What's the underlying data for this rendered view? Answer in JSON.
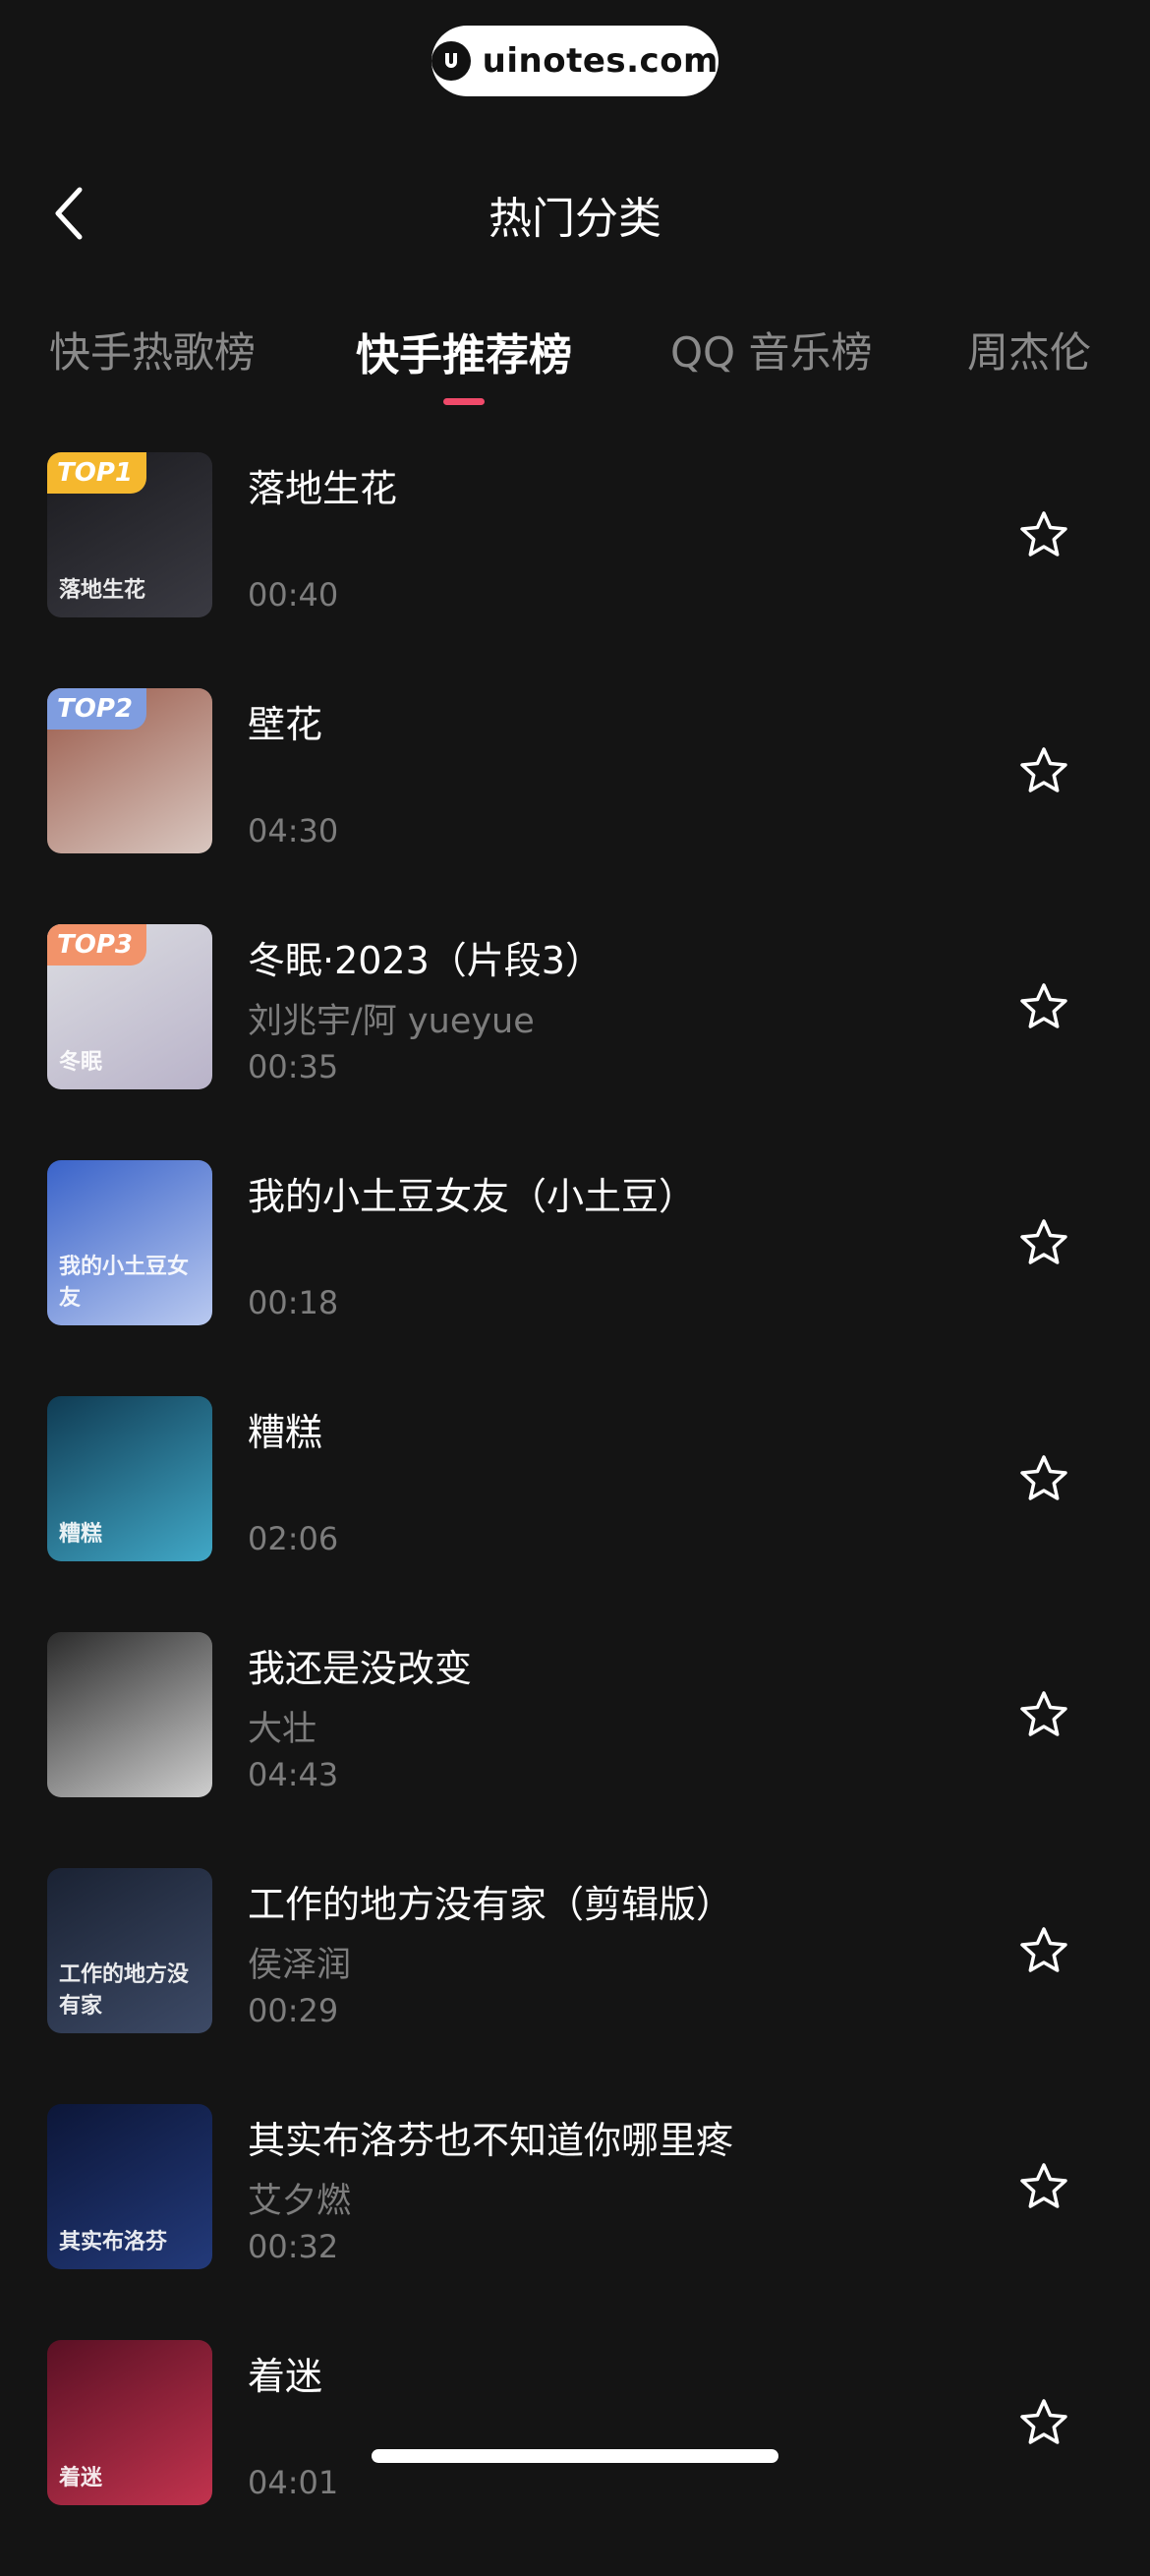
{
  "watermark": {
    "text": "uinotes.com"
  },
  "header": {
    "title": "热门分类"
  },
  "tabs": [
    {
      "label": "快手热歌榜",
      "active": false
    },
    {
      "label": "快手推荐榜",
      "active": true
    },
    {
      "label": "QQ 音乐榜",
      "active": false
    },
    {
      "label": "周杰伦",
      "active": false
    }
  ],
  "songs": [
    {
      "title": "落地生花",
      "artist": "",
      "duration": "00:40",
      "badge": "TOP1",
      "badge_color": "#f5b82e",
      "cover_text": "落地生花",
      "cover_colors": [
        "#1b1b1f",
        "#3a3a42"
      ]
    },
    {
      "title": "壁花",
      "artist": "",
      "duration": "04:30",
      "badge": "TOP2",
      "badge_color": "#7f9de0",
      "cover_text": "",
      "cover_colors": [
        "#9a5a4a",
        "#d9c7c0"
      ]
    },
    {
      "title": "冬眠·2023（片段3）",
      "artist": "刘兆宇/阿 yueyue",
      "duration": "00:35",
      "badge": "TOP3",
      "badge_color": "#f2936a",
      "cover_text": "冬眠",
      "cover_colors": [
        "#dcdde2",
        "#b9b3c9"
      ]
    },
    {
      "title": "我的小土豆女友（小土豆）",
      "artist": "",
      "duration": "00:18",
      "badge": "",
      "badge_color": "",
      "cover_text": "我的小土豆女友",
      "cover_colors": [
        "#3a63c9",
        "#b9c9f0"
      ]
    },
    {
      "title": "糟糕",
      "artist": "",
      "duration": "02:06",
      "badge": "",
      "badge_color": "",
      "cover_text": "糟糕",
      "cover_colors": [
        "#0f3b53",
        "#41a8c7"
      ]
    },
    {
      "title": "我还是没改变",
      "artist": "大壮",
      "duration": "04:43",
      "badge": "",
      "badge_color": "",
      "cover_text": "",
      "cover_colors": [
        "#2b2b2b",
        "#cfcfcf"
      ]
    },
    {
      "title": "工作的地方没有家（剪辑版）",
      "artist": "侯泽润",
      "duration": "00:29",
      "badge": "",
      "badge_color": "",
      "cover_text": "工作的地方没有家",
      "cover_colors": [
        "#1a2233",
        "#3d4a66"
      ]
    },
    {
      "title": "其实布洛芬也不知道你哪里疼",
      "artist": "艾夕燃",
      "duration": "00:32",
      "badge": "",
      "badge_color": "",
      "cover_text": "其实布洛芬",
      "cover_colors": [
        "#0c1638",
        "#233a7a"
      ]
    },
    {
      "title": "着迷",
      "artist": "",
      "duration": "04:01",
      "badge": "",
      "badge_color": "",
      "cover_text": "着迷",
      "cover_colors": [
        "#5a1024",
        "#c2334e"
      ]
    }
  ],
  "colors": {
    "background": "#141414",
    "accent": "#f04a6a",
    "secondary_text": "#7d7d7d"
  }
}
